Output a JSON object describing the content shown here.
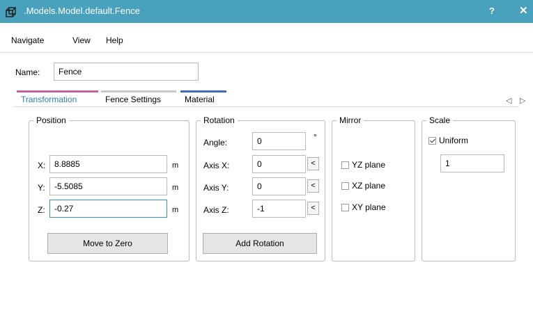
{
  "window": {
    "title": ".Models.Model.default.Fence",
    "help_label": "?",
    "close_label": "✕"
  },
  "menu": [
    "Navigate",
    "View",
    "Help"
  ],
  "name_field": {
    "label": "Name:",
    "value": "Fence"
  },
  "tabs": [
    {
      "label": "Transformation",
      "active": true,
      "color": "#c2619b"
    },
    {
      "label": "Fence Settings",
      "active": false,
      "color": "#c8c8c8"
    },
    {
      "label": "Material",
      "active": false,
      "color": "#3f6bbf"
    }
  ],
  "tab_scroll": {
    "left": "◁",
    "right": "▷"
  },
  "position": {
    "title": "Position",
    "x": {
      "label": "X:",
      "value": "8.8885",
      "unit": "m"
    },
    "y": {
      "label": "Y:",
      "value": "-5.5085",
      "unit": "m"
    },
    "z": {
      "label": "Z:",
      "value": "-0.27",
      "unit": "m"
    },
    "button": "Move to Zero"
  },
  "rotation": {
    "title": "Rotation",
    "angle": {
      "label": "Angle:",
      "value": "0",
      "unit": "°"
    },
    "axis_x": {
      "label": "Axis X:",
      "value": "0"
    },
    "axis_y": {
      "label": "Axis Y:",
      "value": "0"
    },
    "axis_z": {
      "label": "Axis Z:",
      "value": "-1"
    },
    "pick_label": "<",
    "button": "Add Rotation"
  },
  "mirror": {
    "title": "Mirror",
    "options": [
      {
        "label": "YZ plane",
        "checked": false
      },
      {
        "label": "XZ plane",
        "checked": false
      },
      {
        "label": "XY plane",
        "checked": false
      }
    ]
  },
  "scale": {
    "title": "Scale",
    "uniform": {
      "label": "Uniform",
      "checked": true
    },
    "value": "1"
  },
  "colors": {
    "titlebar": "#4aa1bd",
    "active_tab_text": "#2f7fae",
    "focus_border": "#3a8fbd"
  }
}
